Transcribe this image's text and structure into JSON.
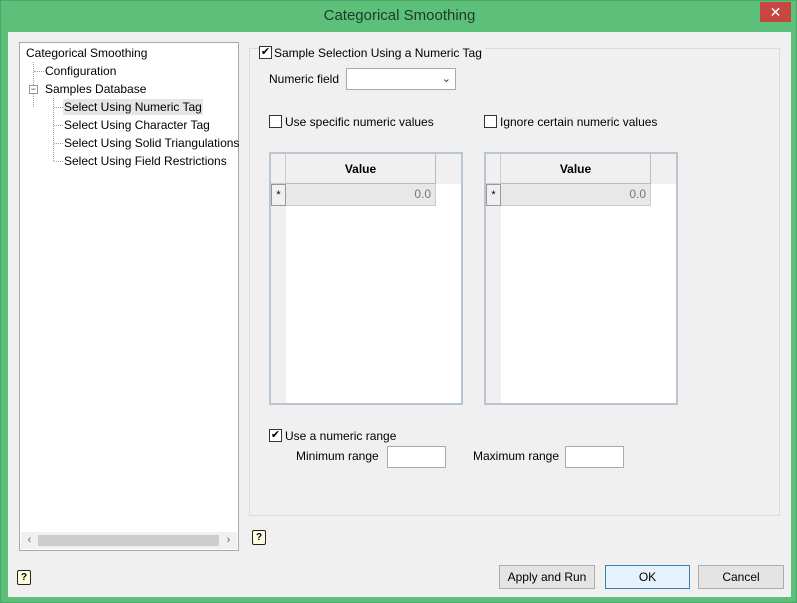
{
  "window": {
    "title": "Categorical Smoothing",
    "close_glyph": "✕"
  },
  "tree": {
    "root": "Categorical Smoothing",
    "items": [
      {
        "label": "Configuration"
      },
      {
        "label": "Samples Database",
        "expander": "−"
      },
      {
        "label": "Select Using Numeric Tag",
        "selected": true
      },
      {
        "label": "Select Using Character Tag"
      },
      {
        "label": "Select Using Solid Triangulations"
      },
      {
        "label": "Select Using Field Restrictions"
      }
    ],
    "scroll_left": "‹",
    "scroll_right": "›"
  },
  "panel": {
    "sample_selection": {
      "label": "Sample Selection Using a Numeric Tag",
      "checked": true
    },
    "numeric_field": {
      "label": "Numeric field",
      "value": ""
    },
    "use_specific": {
      "label": "Use specific numeric values",
      "checked": false
    },
    "ignore_certain": {
      "label": "Ignore certain numeric values",
      "checked": false
    },
    "grid_left": {
      "header": "Value",
      "row_marker": "*",
      "value": "0.0"
    },
    "grid_right": {
      "header": "Value",
      "row_marker": "*",
      "value": "0.0"
    },
    "use_range": {
      "label": "Use a numeric range",
      "checked": true
    },
    "minimum_range": {
      "label": "Minimum range",
      "value": ""
    },
    "maximum_range": {
      "label": "Maximum range",
      "value": ""
    }
  },
  "help_glyph": "?",
  "buttons": {
    "apply_run": "Apply and Run",
    "ok": "OK",
    "cancel": "Cancel"
  },
  "colors": {
    "titlebar": "#5cc07b",
    "close": "#c7463f",
    "client": "#f0f0f0"
  },
  "icons": [
    "close-icon",
    "help-icon",
    "checkmark-icon",
    "chevron-down-icon"
  ]
}
